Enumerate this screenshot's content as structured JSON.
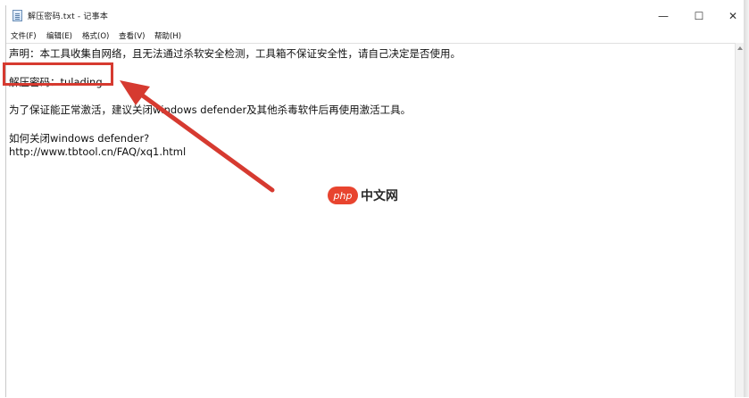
{
  "window": {
    "title": "解压密码.txt - 记事本",
    "controls": {
      "minimize": "—",
      "maximize": "☐",
      "close": "✕"
    }
  },
  "menu": [
    {
      "label": "文件(F)"
    },
    {
      "label": "编辑(E)"
    },
    {
      "label": "格式(O)"
    },
    {
      "label": "查看(V)"
    },
    {
      "label": "帮助(H)"
    }
  ],
  "content": {
    "line1": "声明：本工具收集自网络，且无法通过杀软安全检测，工具箱不保证安全性，请自己决定是否使用。",
    "line2": "解压密码：tulading",
    "line3": "为了保证能正常激活，建议关闭windows defender及其他杀毒软件后再使用激活工具。",
    "line4": "如何关闭windows defender?",
    "line5": "http://www.tbtool.cn/FAQ/xq1.html"
  },
  "annotation": {
    "color": "#d63a30",
    "icon": "red-arrow-icon"
  },
  "watermark": {
    "badge": "php",
    "text": "中文网"
  }
}
